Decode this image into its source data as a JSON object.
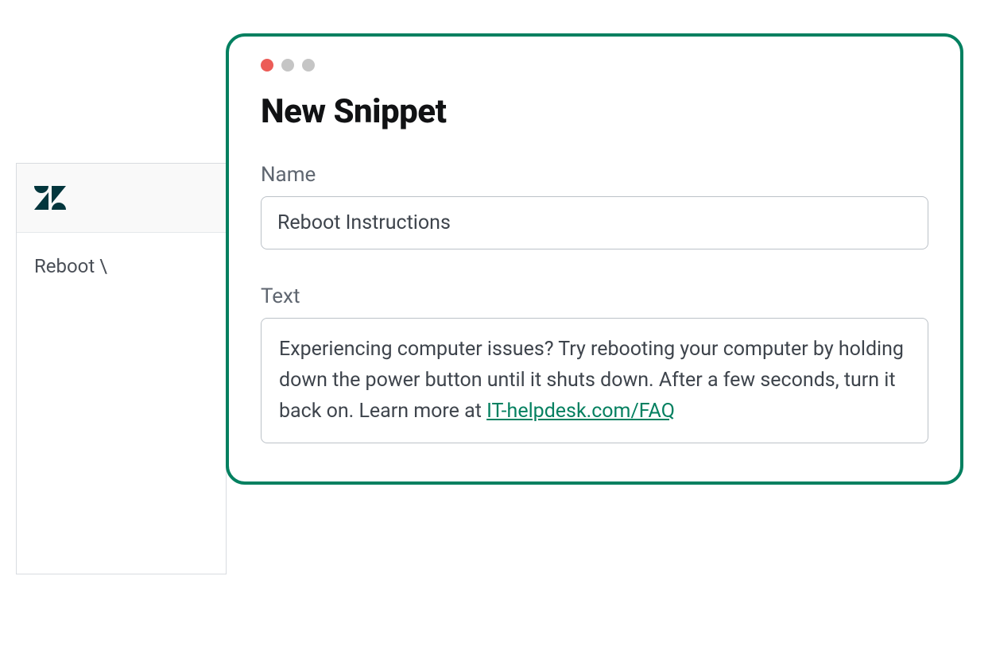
{
  "sidebar": {
    "logo_name": "zendesk-logo",
    "items": [
      {
        "label": "Reboot \\"
      }
    ]
  },
  "modal": {
    "title": "New Snippet",
    "fields": {
      "name": {
        "label": "Name",
        "value": "Reboot Instructions"
      },
      "text": {
        "label": "Text",
        "value_before_link": "Experiencing computer issues? Try rebooting your computer by holding down the power button until it shuts down. After a few seconds, turn it back on. Learn more at ",
        "link_text": "IT-helpdesk.com/FAQ"
      }
    }
  },
  "colors": {
    "accent": "#048060",
    "traffic_red": "#ec5c57",
    "traffic_inactive": "#c5c5c5"
  }
}
